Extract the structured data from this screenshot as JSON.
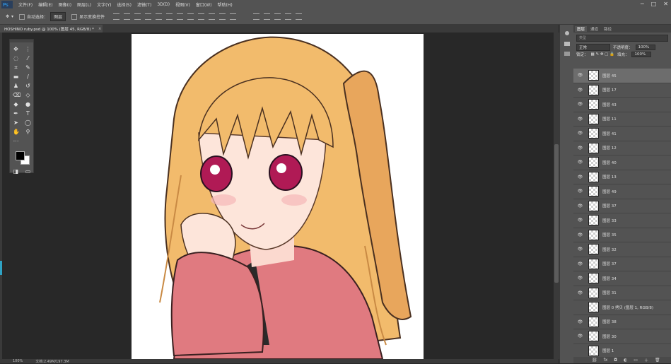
{
  "menubar": {
    "items": [
      "文件(F)",
      "编辑(E)",
      "图像(I)",
      "图层(L)",
      "文字(Y)",
      "选择(S)",
      "滤镜(T)",
      "3D(D)",
      "视图(V)",
      "窗口(W)",
      "帮助(H)"
    ]
  },
  "options": {
    "auto_select_label": "自动选择：",
    "auto_select_value": "图层",
    "transform_label": "显示变换控件"
  },
  "document": {
    "tab_title": "HOSHINO ruby.psd @ 100% (图层 45, RGB/8) *",
    "tab_close": "×"
  },
  "status": {
    "zoom": "100%",
    "doc_size": "文档:2.49M/197.3M"
  },
  "panel": {
    "tabs": [
      "图层",
      "通道",
      "路径"
    ],
    "search_placeholder": "类型",
    "blend_mode": "正常",
    "opacity_label": "不透明度：",
    "opacity_value": "100%",
    "lock_label": "锁定：",
    "fill_label": "填充：",
    "fill_value": "100%",
    "layers": [
      {
        "name": "图层 45",
        "visible": true,
        "selected": true
      },
      {
        "name": "图层 17",
        "visible": true,
        "selected": false
      },
      {
        "name": "图层 43",
        "visible": true,
        "selected": false
      },
      {
        "name": "图层 11",
        "visible": true,
        "selected": false
      },
      {
        "name": "图层 41",
        "visible": true,
        "selected": false
      },
      {
        "name": "图层 12",
        "visible": true,
        "selected": false
      },
      {
        "name": "图层 40",
        "visible": true,
        "selected": false
      },
      {
        "name": "图层 13",
        "visible": true,
        "selected": false
      },
      {
        "name": "图层 49",
        "visible": true,
        "selected": false
      },
      {
        "name": "图层 37",
        "visible": true,
        "selected": false
      },
      {
        "name": "图层 33",
        "visible": true,
        "selected": false
      },
      {
        "name": "图层 35",
        "visible": true,
        "selected": false
      },
      {
        "name": "图层 32",
        "visible": true,
        "selected": false
      },
      {
        "name": "图层 37",
        "visible": true,
        "selected": false
      },
      {
        "name": "图层 34",
        "visible": true,
        "selected": false
      },
      {
        "name": "图层 31",
        "visible": true,
        "selected": false
      },
      {
        "name": "图层 0 拷贝 (图层 1, RGB/8)",
        "visible": false,
        "selected": false
      },
      {
        "name": "图层 38",
        "visible": true,
        "selected": false
      },
      {
        "name": "图层 30",
        "visible": true,
        "selected": false
      },
      {
        "name": "图层 1",
        "visible": false,
        "selected": false
      }
    ]
  },
  "colors": {
    "ui_bg": "#535353",
    "workspace": "#282828",
    "selected_layer": "#6d6d6d",
    "hair": "#f0b868",
    "hoodie": "#e07a80",
    "eye": "#b01a55"
  }
}
